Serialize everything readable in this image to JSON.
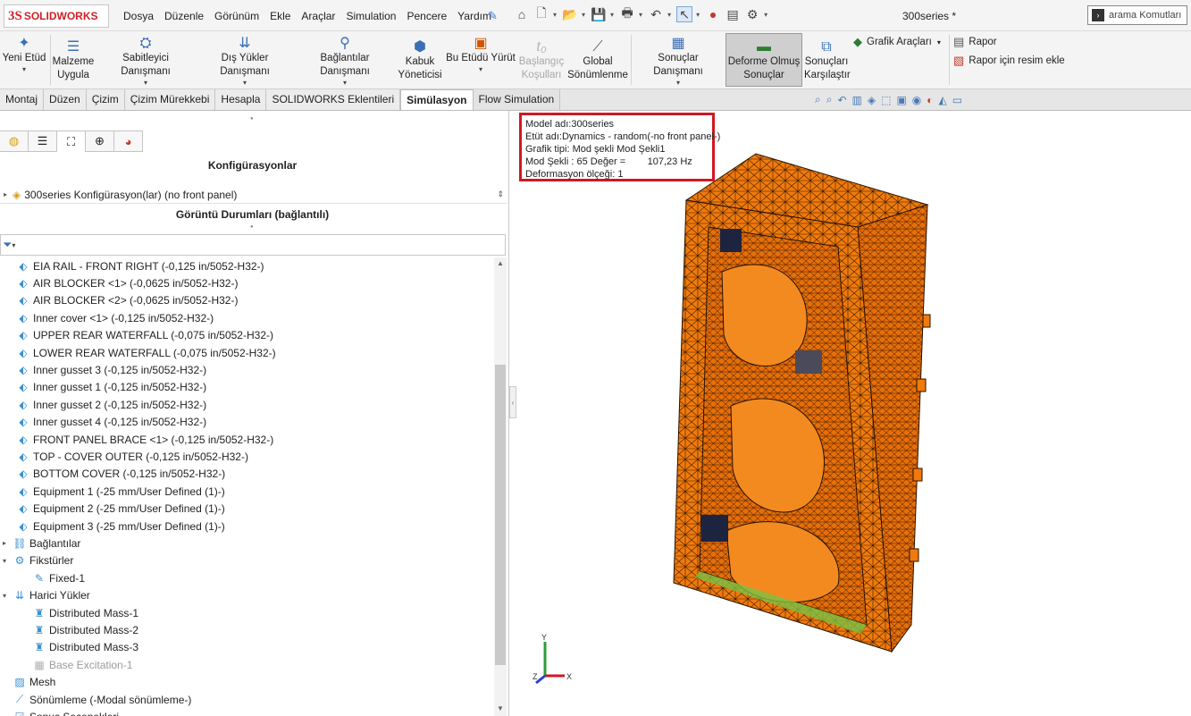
{
  "app": {
    "logo_ds": "3S",
    "logo_text": "SOLIDWORKS",
    "document_title": "300series *"
  },
  "menu": [
    "Dosya",
    "Düzenle",
    "Görünüm",
    "Ekle",
    "Araçlar",
    "Simulation",
    "Pencere",
    "Yardım"
  ],
  "search": {
    "placeholder": "arama Komutları"
  },
  "ribbon": {
    "new_study": "Yeni Etüd",
    "apply_material": [
      "Malzeme",
      "Uygula"
    ],
    "fixtures_advisor": "Sabitleyici Danışmanı",
    "external_loads_advisor": "Dış Yükler Danışmanı",
    "connections_advisor": "Bağlantılar Danışmanı",
    "shell_manager": [
      "Kabuk",
      "Yöneticisi"
    ],
    "run_study": "Bu Etüdü Yürüt",
    "initial_conditions": [
      "Başlangıç",
      "Koşulları"
    ],
    "global_damping": [
      "Global",
      "Sönümlenme"
    ],
    "results_advisor": "Sonuçlar Danışmanı",
    "deformed_results": [
      "Deforme Olmuş",
      "Sonuçlar"
    ],
    "compare_results": [
      "Sonuçları",
      "Karşılaştır"
    ],
    "plot_tools": "Grafik Araçları",
    "report": "Rapor",
    "include_image": "Rapor için resim ekle"
  },
  "tabs": [
    {
      "label": "Montaj",
      "state": "normal"
    },
    {
      "label": "Düzen",
      "state": "normal"
    },
    {
      "label": "Çizim",
      "state": "normal"
    },
    {
      "label": "Çizim Mürekkebi",
      "state": "normal"
    },
    {
      "label": "Hesapla",
      "state": "normal"
    },
    {
      "label": "SOLIDWORKS Eklentileri",
      "state": "normal"
    },
    {
      "label": "Simülasyon",
      "state": "active"
    },
    {
      "label": "Flow Simulation",
      "state": "light"
    }
  ],
  "panel": {
    "config_title": "Konfigürasyonlar",
    "config_row": "300series Konfigürasyon(lar)  (no front panel)",
    "display_states_title": "Görüntü Durumları (bağlantılı)"
  },
  "tree": [
    {
      "label": "EIA RAIL - FRONT RIGHT (-0,125 in/5052-H32-)",
      "icon": "shell-icon",
      "indent": 1
    },
    {
      "label": "AIR BLOCKER <1> (-0,0625 in/5052-H32-)",
      "icon": "shell-icon",
      "indent": 1
    },
    {
      "label": "AIR BLOCKER <2> (-0,0625 in/5052-H32-)",
      "icon": "shell-icon",
      "indent": 1
    },
    {
      "label": "Inner cover <1> (-0,125 in/5052-H32-)",
      "icon": "shell-icon",
      "indent": 1
    },
    {
      "label": "UPPER REAR WATERFALL (-0,075 in/5052-H32-)",
      "icon": "shell-icon",
      "indent": 1
    },
    {
      "label": "LOWER REAR WATERFALL (-0,075 in/5052-H32-)",
      "icon": "shell-icon",
      "indent": 1
    },
    {
      "label": "Inner gusset 3 (-0,125 in/5052-H32-)",
      "icon": "shell-icon",
      "indent": 1
    },
    {
      "label": "Inner gusset 1 (-0,125 in/5052-H32-)",
      "icon": "shell-icon",
      "indent": 1
    },
    {
      "label": "Inner gusset 2 (-0,125 in/5052-H32-)",
      "icon": "shell-icon",
      "indent": 1
    },
    {
      "label": "Inner gusset 4 (-0,125 in/5052-H32-)",
      "icon": "shell-icon",
      "indent": 1
    },
    {
      "label": "FRONT PANEL BRACE <1> (-0,125 in/5052-H32-)",
      "icon": "shell-icon",
      "indent": 1
    },
    {
      "label": "TOP - COVER OUTER (-0,125 in/5052-H32-)",
      "icon": "shell-icon",
      "indent": 1
    },
    {
      "label": "BOTTOM COVER (-0,125 in/5052-H32-)",
      "icon": "shell-icon",
      "indent": 1
    },
    {
      "label": "Equipment 1 (-25 mm/User Defined (1)-)",
      "icon": "shell-icon",
      "indent": 1
    },
    {
      "label": "Equipment 2 (-25 mm/User Defined (1)-)",
      "icon": "shell-icon",
      "indent": 1
    },
    {
      "label": "Equipment 3 (-25 mm/User Defined (1)-)",
      "icon": "shell-icon",
      "indent": 1
    },
    {
      "label": "Bağlantılar",
      "icon": "connections-icon",
      "indent": 0,
      "expander": "▸"
    },
    {
      "label": "Fikstürler",
      "icon": "fixtures-icon",
      "indent": 0,
      "expander": "▾"
    },
    {
      "label": "Fixed-1",
      "icon": "fixed-icon",
      "indent": 2
    },
    {
      "label": "Harici Yükler",
      "icon": "loads-icon",
      "indent": 0,
      "expander": "▾"
    },
    {
      "label": "Distributed Mass-1",
      "icon": "mass-icon",
      "indent": 2
    },
    {
      "label": "Distributed Mass-2",
      "icon": "mass-icon",
      "indent": 2
    },
    {
      "label": "Distributed Mass-3",
      "icon": "mass-icon",
      "indent": 2
    },
    {
      "label": "Base Excitation-1",
      "icon": "excitation-icon",
      "indent": 2,
      "dim": true
    },
    {
      "label": "Mesh",
      "icon": "mesh-icon",
      "indent": 0
    },
    {
      "label": "Sönümleme (-Modal sönümleme-)",
      "icon": "damping-icon",
      "indent": 0
    },
    {
      "label": "Sonuç Seçenekleri",
      "icon": "result-options-icon",
      "indent": 0
    }
  ],
  "info": {
    "model_name": "Model adı:300series",
    "study_name": "Etüt adı:Dynamics - random(-no front panel-)",
    "plot_type": "Grafik tipi: Mod şekli Mod Şekli1",
    "mode_shape": "Mod Şekli : 65 Değer =        107,23 Hz",
    "deformation_scale": "Deformasyon ölçeği: 1"
  },
  "triad": {
    "x": "X",
    "y": "Y",
    "z": "Z"
  },
  "colors": {
    "accent_red": "#d01822",
    "mesh_orange": "#f07a0c",
    "brand": "#d21f26"
  }
}
